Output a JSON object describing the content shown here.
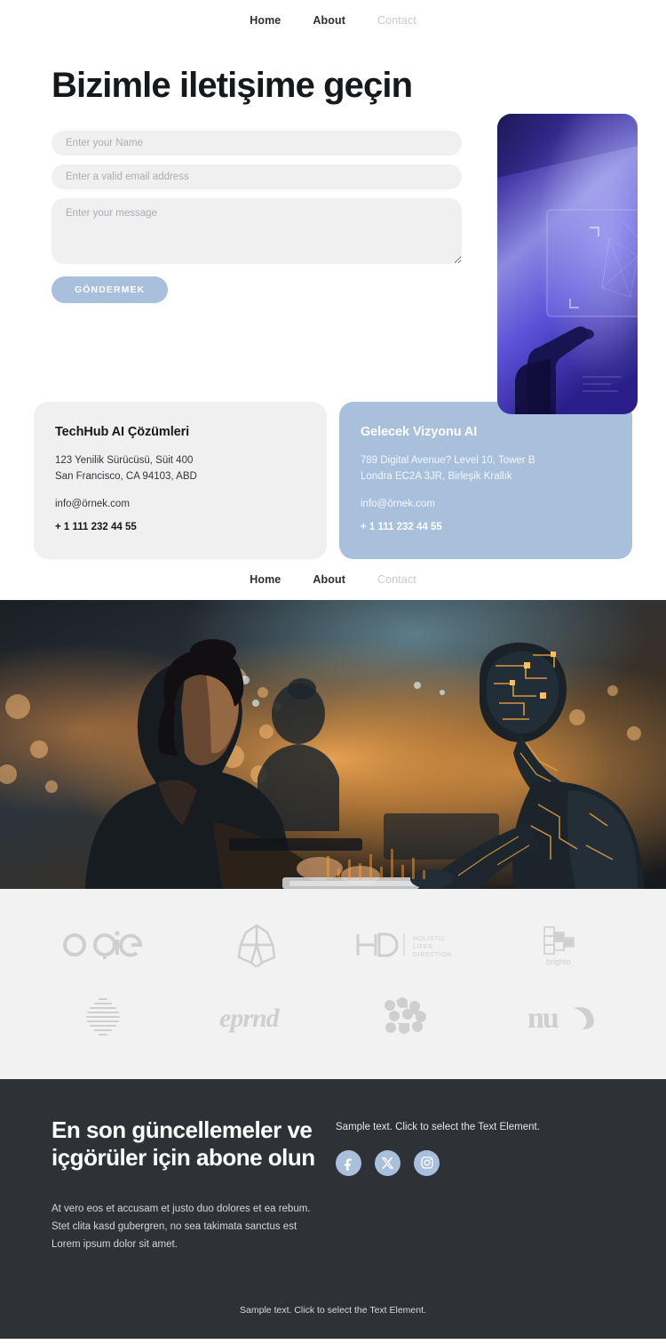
{
  "nav_primary": {
    "items": [
      {
        "label": "Home",
        "state": "active"
      },
      {
        "label": "About",
        "state": "active"
      },
      {
        "label": "Contact",
        "state": "muted"
      }
    ]
  },
  "nav_secondary": {
    "items": [
      {
        "label": "Home",
        "state": "active"
      },
      {
        "label": "About",
        "state": "active"
      },
      {
        "label": "Contact",
        "state": "muted"
      }
    ]
  },
  "hero": {
    "title": "Bizimle iletişime geçin",
    "image_alt": "hand touching holographic interface",
    "form": {
      "name_placeholder": "Enter your Name",
      "email_placeholder": "Enter a valid email address",
      "message_placeholder": "Enter your message",
      "submit_label": "GÖNDERMEK",
      "name_value": "",
      "email_value": "",
      "message_value": ""
    }
  },
  "contact_cards": [
    {
      "title": "TechHub AI Çözümleri",
      "address_line_1": "123 Yenilik Sürücüsü, Süit 400",
      "address_line_2": "San Francisco, CA 94103, ABD",
      "email": "info@örnek.com",
      "phone": "+ 1 111 232 44 55",
      "variant": "grey"
    },
    {
      "title": "Gelecek Vizyonu AI",
      "address_line_1": "789 Digital Avenue? Level 10, Tower B",
      "address_line_2": "Londra EC2A 3JR, Birleşik Krallık",
      "email": "info@örnek.com",
      "phone": "+ 1 111 232 44 55",
      "variant": "blue"
    }
  ],
  "banner": {
    "alt": "woman working at keyboard beside glowing humanoid robot"
  },
  "logos": [
    {
      "name": "ogie",
      "kind": "wordmark"
    },
    {
      "name": "flower-star",
      "kind": "mark"
    },
    {
      "name": "HD",
      "kind": "wordmark",
      "sub_line_1": "HOLISTIC",
      "sub_line_2": "LIFES",
      "sub_line_3": "DIRECTION"
    },
    {
      "name": "brighto",
      "kind": "wordmark"
    },
    {
      "name": "striped-sphere",
      "kind": "mark"
    },
    {
      "name": "eprnd",
      "kind": "wordmark"
    },
    {
      "name": "dot-cluster",
      "kind": "mark"
    },
    {
      "name": "nu",
      "kind": "wordmark"
    }
  ],
  "footer": {
    "title": "En son güncellemeler ve içgörüler için abone olun",
    "body": "At vero eos et accusam et justo duo dolores et ea rebum. Stet clita kasd gubergren, no sea takimata sanctus est Lorem ipsum dolor sit amet.",
    "sample_text": "Sample text. Click to select the Text Element.",
    "socials": [
      {
        "name": "facebook"
      },
      {
        "name": "x-twitter"
      },
      {
        "name": "instagram"
      }
    ],
    "bottom_text": "Sample text. Click to select the Text Element."
  },
  "colors": {
    "accent_blue": "#a8c0dc",
    "field_grey": "#f0f0f0",
    "footer_dark": "#2e3236",
    "logo_strip": "#f2f2f2",
    "text_dark": "#16191c",
    "text_muted": "#c6cbd1"
  }
}
